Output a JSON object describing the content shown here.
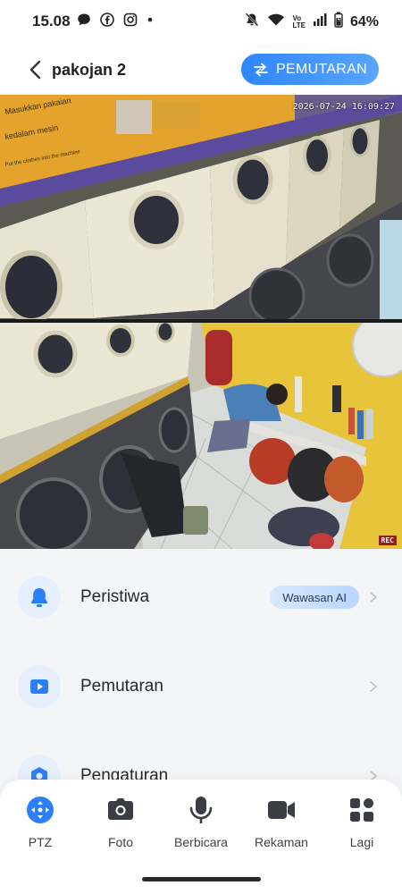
{
  "status_bar": {
    "time": "15.08",
    "battery": "64%",
    "volte_label": "Vo LTE"
  },
  "header": {
    "title": "pakojan 2",
    "playback_button": "PEMUTARAN"
  },
  "video": {
    "camera1_timestamp": "2026-07-24 16:09:27",
    "camera2_rec": "REC",
    "sign_text_1": "Masukkan pakaian",
    "sign_text_2": "kedalam mesin",
    "sign_text_3": "Put the clothes into the machine"
  },
  "menu": {
    "items": [
      {
        "label": "Peristiwa",
        "icon": "bell-icon",
        "badge": "Wawasan AI"
      },
      {
        "label": "Pemutaran",
        "icon": "play-icon"
      },
      {
        "label": "Pengaturan",
        "icon": "settings-icon"
      }
    ]
  },
  "toolbar": {
    "items": [
      {
        "label": "PTZ",
        "icon": "ptz-icon",
        "active": true
      },
      {
        "label": "Foto",
        "icon": "camera-icon"
      },
      {
        "label": "Berbicara",
        "icon": "microphone-icon"
      },
      {
        "label": "Rekaman",
        "icon": "video-record-icon"
      },
      {
        "label": "Lagi",
        "icon": "more-grid-icon"
      }
    ]
  },
  "colors": {
    "accent": "#2f86ff",
    "icon_blue": "#2d7ff9",
    "wall_yellow": "#e8c43a",
    "machine_white": "#ece7d4"
  }
}
